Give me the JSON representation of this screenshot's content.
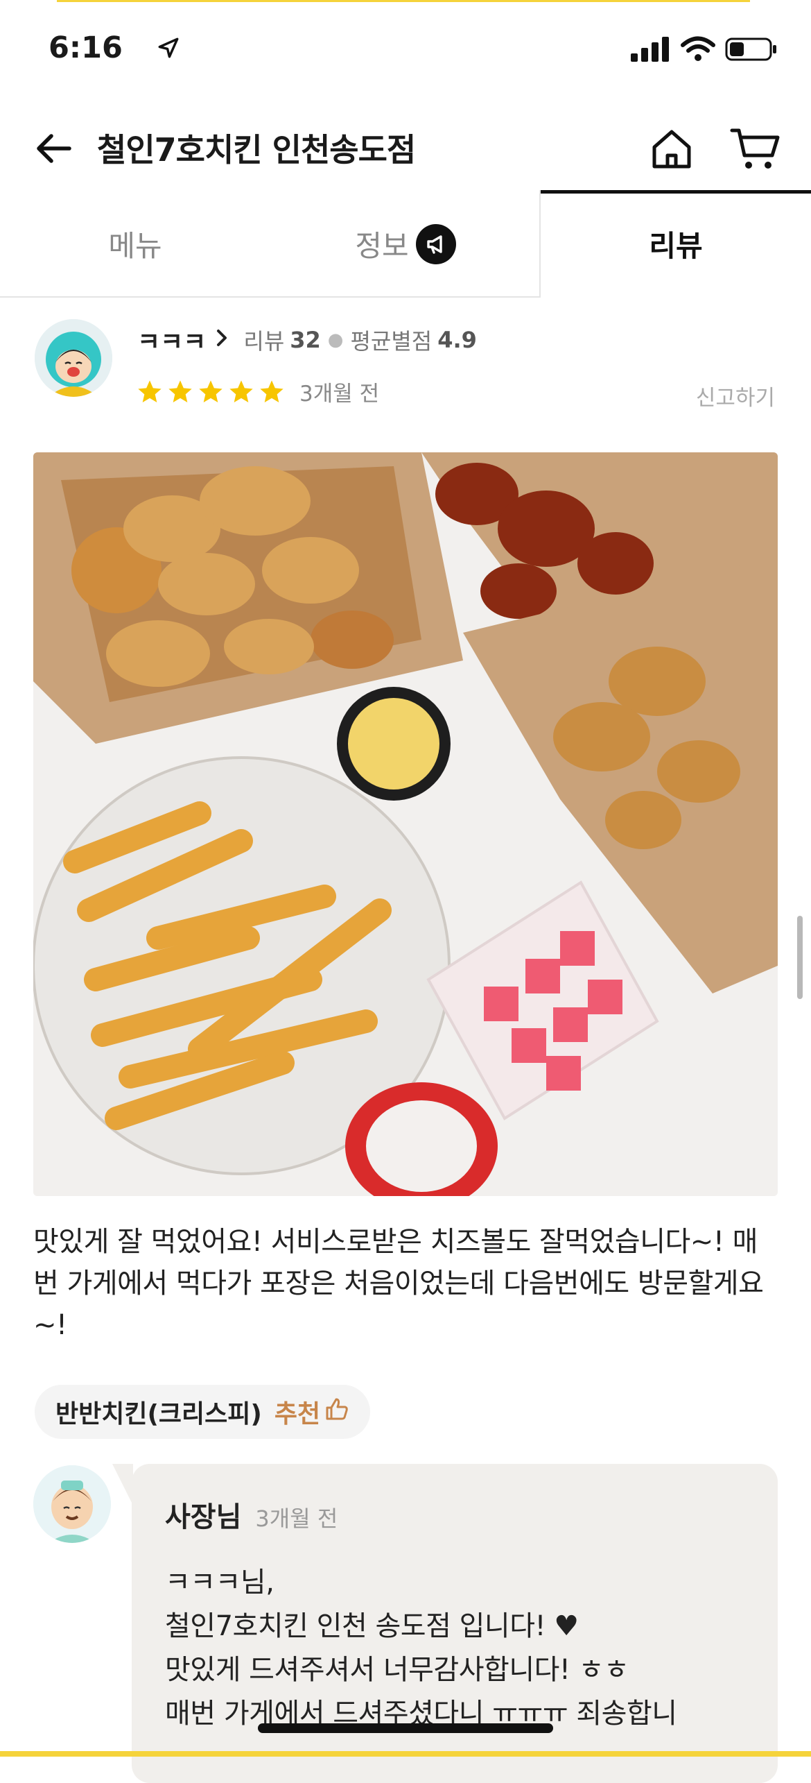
{
  "status_bar": {
    "time": "6:16"
  },
  "header": {
    "title": "철인7호치킨 인천송도점"
  },
  "tabs": [
    {
      "label": "메뉴"
    },
    {
      "label": "정보"
    },
    {
      "label": "리뷰"
    }
  ],
  "review": {
    "reviewer_name": "ㅋㅋㅋ",
    "review_count_label": "리뷰",
    "review_count": "32",
    "avg_rating_label": "평균별점",
    "avg_rating": "4.9",
    "stars": 5,
    "time_ago": "3개월 전",
    "report_label": "신고하기",
    "text": "맛있게 잘 먹었어요! 서비스로받은 치즈볼도 잘먹었습니다~! 매번 가게에서 먹다가 포장은 처음이었는데 다음번에도 방문할게요~!",
    "menu_name": "반반치킨(크리스피)",
    "recommend_label": "추천"
  },
  "owner_reply": {
    "name": "사장님",
    "time_ago": "3개월 전",
    "lines": [
      "ㅋㅋㅋ님,",
      "철인7호치킨 인천 송도점 입니다! ♥",
      "맛있게 드셔주셔서 너무감사합니다! ㅎㅎ",
      "매번 가게에서 드셔주셨다니 ㅠㅠㅠ 죄송합니"
    ]
  },
  "colors": {
    "star": "#f7c500",
    "accent": "#f5d33b",
    "recommend": "#c7854a"
  }
}
